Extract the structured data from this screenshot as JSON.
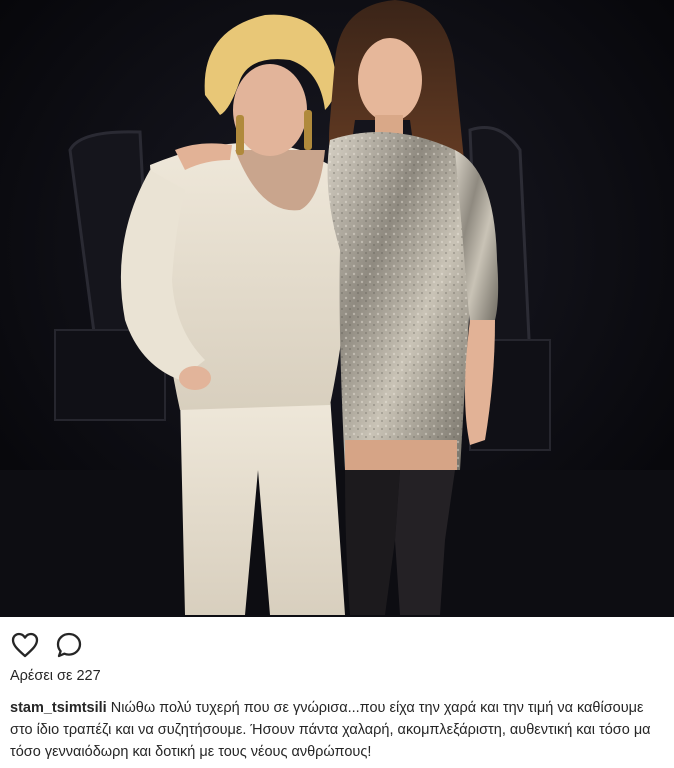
{
  "post": {
    "photo_description_icon": "photo",
    "actions": {
      "like_icon": "heart-outline-icon",
      "comment_icon": "speech-bubble-icon"
    },
    "likes_text": "Αρέσει σε 227",
    "caption": {
      "username": "stam_tsimtsili",
      "text": "Νιώθω πολύ τυχερή που σε γνώρισα...που είχα την χαρά και την τιμή να καθίσουμε στο ίδιο τραπέζι και να συζητήσουμε. Ήσουν πάντα χαλαρή, ακομπλεξάριστη, αυθεντική και τόσο μα τόσο γενναιόδωρη και δοτική με τους νέους ανθρώπους!"
    }
  },
  "colors": {
    "text": "#262626",
    "photo_background": "#0b0b10"
  }
}
